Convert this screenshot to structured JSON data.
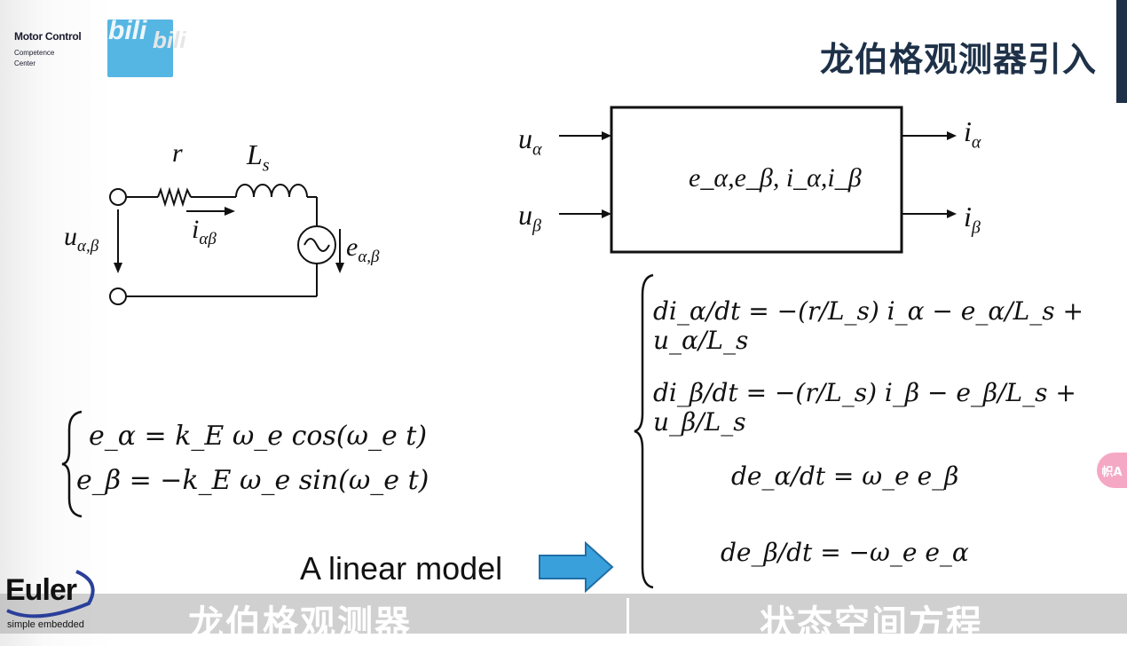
{
  "header": {
    "logo_line1": "Motor Control",
    "logo_line2": "Competence",
    "logo_line3": "Center",
    "bili_mark": "bili",
    "bili_ghost": "bili",
    "title": "龙伯格观测器引入"
  },
  "circuit": {
    "resistor": "r",
    "inductor_base": "L",
    "inductor_sub": "s",
    "voltage_base": "u",
    "voltage_sub": "α,β",
    "current_base": "i",
    "current_sub": "αβ",
    "emf_base": "e",
    "emf_sub": "α,β"
  },
  "block": {
    "in1_base": "u",
    "in1_sub": "α",
    "in2_base": "u",
    "in2_sub": "β",
    "out1_base": "i",
    "out1_sub": "α",
    "out2_base": "i",
    "out2_sub": "β",
    "states": "e_α,e_β, i_α,i_β"
  },
  "emf_equations": {
    "line1": "e_α = k_E ω_e cos(ω_e t)",
    "line2": "e_β = −k_E ω_e sin(ω_e t)"
  },
  "state_equations": {
    "eq1": "di_α/dt = −(r/L_s) i_α − e_α/L_s + u_α/L_s",
    "eq2": "di_β/dt = −(r/L_s) i_β − e_β/L_s + u_β/L_s",
    "eq3": "de_α/dt = ω_e e_β",
    "eq4": "de_β/dt = −ω_e e_α"
  },
  "linear_label": "A linear model",
  "footer": {
    "brand": "Euler",
    "brand_sub": "simple embedded",
    "subtitle_left": "龙伯格观测器",
    "subtitle_right": "状态空间方程"
  },
  "badge": "帜A",
  "colors": {
    "title": "#1e3148",
    "bili_blue": "#56b6e3",
    "arrow_blue": "#3aa0dc",
    "badge_pink": "#f5a8c4"
  },
  "icons": {
    "voltage_source": "ac-source-icon",
    "big_arrow": "right-arrow-icon",
    "translate": "translate-icon"
  }
}
